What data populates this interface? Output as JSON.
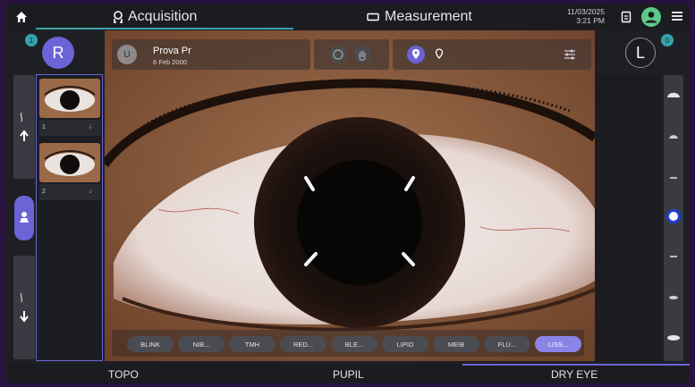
{
  "topbar": {
    "home_icon": "home-icon",
    "tab_acquisition": "Acquisition",
    "tab_measurement": "Measurement",
    "date": "11/03/2025",
    "time": "3:21 PM",
    "accent": "#3fa3ab"
  },
  "left": {
    "eye_label": "R",
    "badge": "1",
    "thumbnails": [
      {
        "index": "1"
      },
      {
        "index": "2"
      }
    ]
  },
  "right": {
    "eye_label": "L",
    "badge": "0"
  },
  "patient": {
    "avatar": "U",
    "name": "Prova Pr",
    "dob": "6 Feb 2000"
  },
  "chips": [
    {
      "label": "BLINK",
      "active": false
    },
    {
      "label": "NIB...",
      "active": false
    },
    {
      "label": "TMH",
      "active": false
    },
    {
      "label": "RED...",
      "active": false
    },
    {
      "label": "BLE...",
      "active": false
    },
    {
      "label": "LIPID",
      "active": false
    },
    {
      "label": "MEIB",
      "active": false
    },
    {
      "label": "FLU...",
      "active": false
    },
    {
      "label": "LISS...",
      "active": true
    }
  ],
  "bottom_tabs": {
    "topo": "TOPO",
    "pupil": "PUPIL",
    "dry_eye": "DRY EYE",
    "selected": "DRY EYE"
  },
  "colors": {
    "accent_purple": "#6c63d6",
    "teal": "#34a3ab",
    "slider_active": "#1f3dd6"
  }
}
